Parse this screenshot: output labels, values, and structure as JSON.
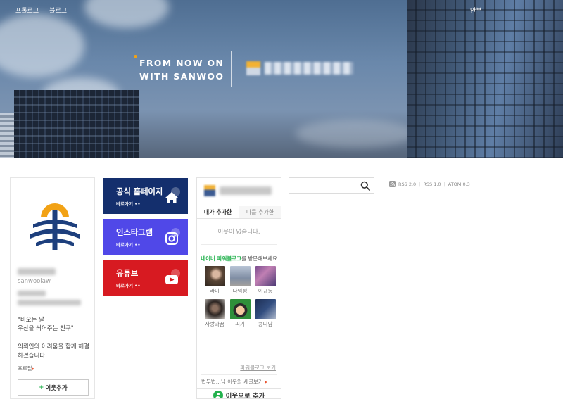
{
  "header": {
    "nav": [
      "프롤로그",
      "블로그"
    ],
    "nav_separator": "|",
    "right_link": "안부",
    "slogan_line1": "FROM NOW ON",
    "slogan_line2": "WITH SANWOO",
    "logo_icon": "sanwoo-logo-icon"
  },
  "profile": {
    "blog_id": "sanwoolaw",
    "quote_line1": "\"비오는 날",
    "quote_line2": "우산을 씌어주는 친구\"",
    "intro": "의뢰인의 어려움을 함께 해결하겠습니다",
    "profile_link": "프로필",
    "add_neighbor": "이웃추가",
    "add_icon": "plus-icon"
  },
  "banners": [
    {
      "title": "공식 홈페이지",
      "sub": "바로가기 ••",
      "icon": "home-icon",
      "color": "#142f6d"
    },
    {
      "title": "인스타그램",
      "sub": "바로가기 ••",
      "icon": "instagram-icon",
      "color": "#5048e8"
    },
    {
      "title": "유튜브",
      "sub": "바로가기 ••",
      "icon": "youtube-icon",
      "color": "#d71a21"
    }
  ],
  "neighbors": {
    "tabs": [
      "내가 추가한",
      "나를 추가한"
    ],
    "empty_text": "이웃이 없습니다.",
    "powerblog_prefix": "네이버 파워블로그",
    "powerblog_suffix": "를 방문해보세요",
    "powerblogs": [
      "라미",
      "나임성",
      "이규동",
      "사랑과꿈",
      "피기",
      "콩디담"
    ],
    "powerblog_link": "파워블로그 보기",
    "neighbor_new_posts": "법무법...님 이웃의 새글보기",
    "add_as_neighbor": "이웃으로 추가",
    "accent_color": "#23b14d"
  },
  "search": {
    "value": "",
    "placeholder": "",
    "icon": "search-icon"
  },
  "rss": {
    "icon": "rss-icon",
    "links": [
      "RSS 2.0",
      "RSS 1.0",
      "ATOM 0.3"
    ],
    "separator": "|"
  }
}
